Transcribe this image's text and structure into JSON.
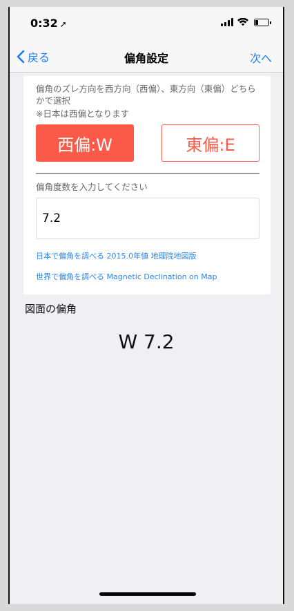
{
  "status": {
    "time": "0:32"
  },
  "nav": {
    "back_label": "戻る",
    "title": "偏角設定",
    "next_label": "次へ"
  },
  "form": {
    "description": "偏角のズレ方向を西方向（西偏）、東方向（東偏）どちらかで選択",
    "note": "※日本は西偏となります",
    "west_button": "西偏:W",
    "east_button": "東偏:E",
    "selected": "west",
    "input_label": "偏角度数を入力してください",
    "input_value": "7.2",
    "link_japan": "日本で偏角を調べる 2015.0年値 地理院地図版",
    "link_world": "世界で偏角を調べる Magnetic Declination on Map"
  },
  "result": {
    "label": "図面の偏角",
    "value": "W 7.2"
  },
  "colors": {
    "accent": "#fb5a48",
    "link": "#2a86e8",
    "nav_tint": "#1a7cf5"
  }
}
